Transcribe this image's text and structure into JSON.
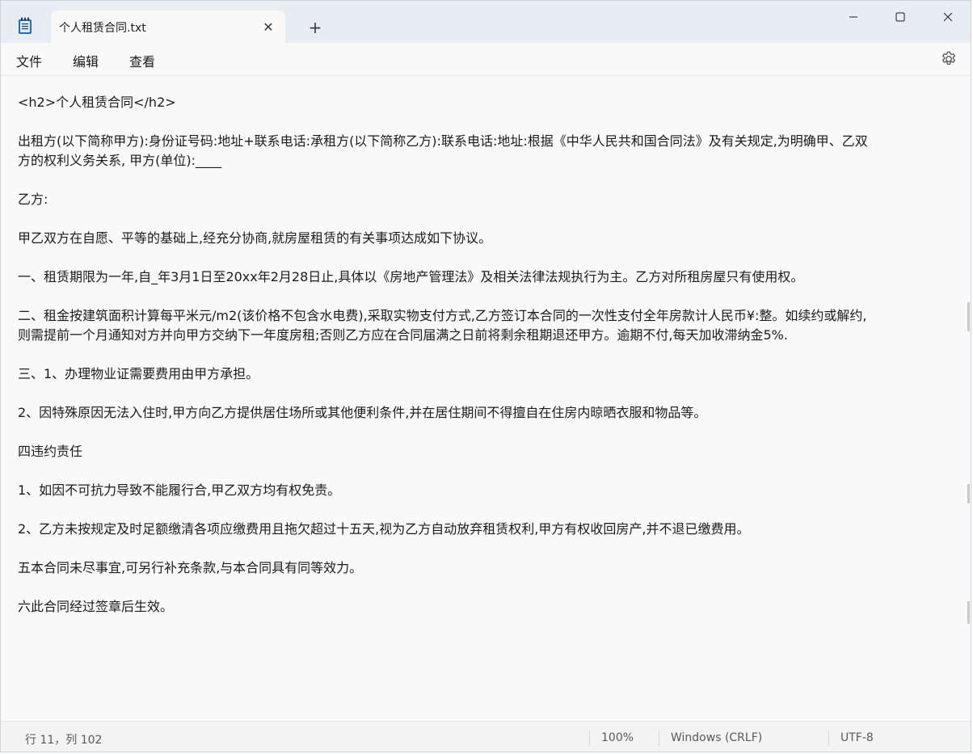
{
  "window": {
    "tab_title": "个人租赁合同.txt",
    "new_tab_label": "+"
  },
  "menu": {
    "items": [
      "文件",
      "编辑",
      "查看"
    ]
  },
  "editor": {
    "lines": [
      "<h2>个人租赁合同</h2>",
      "出租方(以下简称甲方):身份证号码:地址+联系电话:承租方(以下简称乙方):联系电话:地址:根据《中华人民共和国合同法》及有关规定,为明确甲、乙双",
      "方的权利义务关系, 甲方(单位):____",
      "乙方:",
      "甲乙双方在自愿、平等的基础上,经充分协商,就房屋租赁的有关事项达成如下协议。",
      "一、租赁期限为一年,自_年3月1日至20xx年2月28日止,具体以《房地产管理法》及相关法律法规执行为主。乙方对所租房屋只有使用权。",
      "二、租金按建筑面积计算每平米元/m2(该价格不包含水电费),采取实物支付方式,乙方签订本合同的一次性支付全年房款计人民币¥:整。如续约或解约,",
      "则需提前一个月通知对方并向甲方交纳下一年度房租;否则乙方应在合同届满之日前将剩余租期退还甲方。逾期不付,每天加收滞纳金5%.",
      "三、1、办理物业证需要费用由甲方承担。",
      "2、因特殊原因无法入住时,甲方向乙方提供居住场所或其他便利条件,并在居住期间不得擅自在住房内晾晒衣服和物品等。",
      "四违约责任",
      "1、如因不可抗力导致不能履行合,甲乙双方均有权免责。",
      "2、乙方未按规定及时足额缴清各项应缴费用且拖欠超过十五天,视为乙方自动放弃租赁权利,甲方有权收回房产,并不退已缴费用。",
      "五本合同未尽事宜,可另行补充条款,与本合同具有同等效力。",
      "六此合同经过签章后生效。"
    ]
  },
  "status": {
    "position": "行 11，列 102",
    "zoom": "100%",
    "line_ending": "Windows (CRLF)",
    "encoding": "UTF-8"
  }
}
